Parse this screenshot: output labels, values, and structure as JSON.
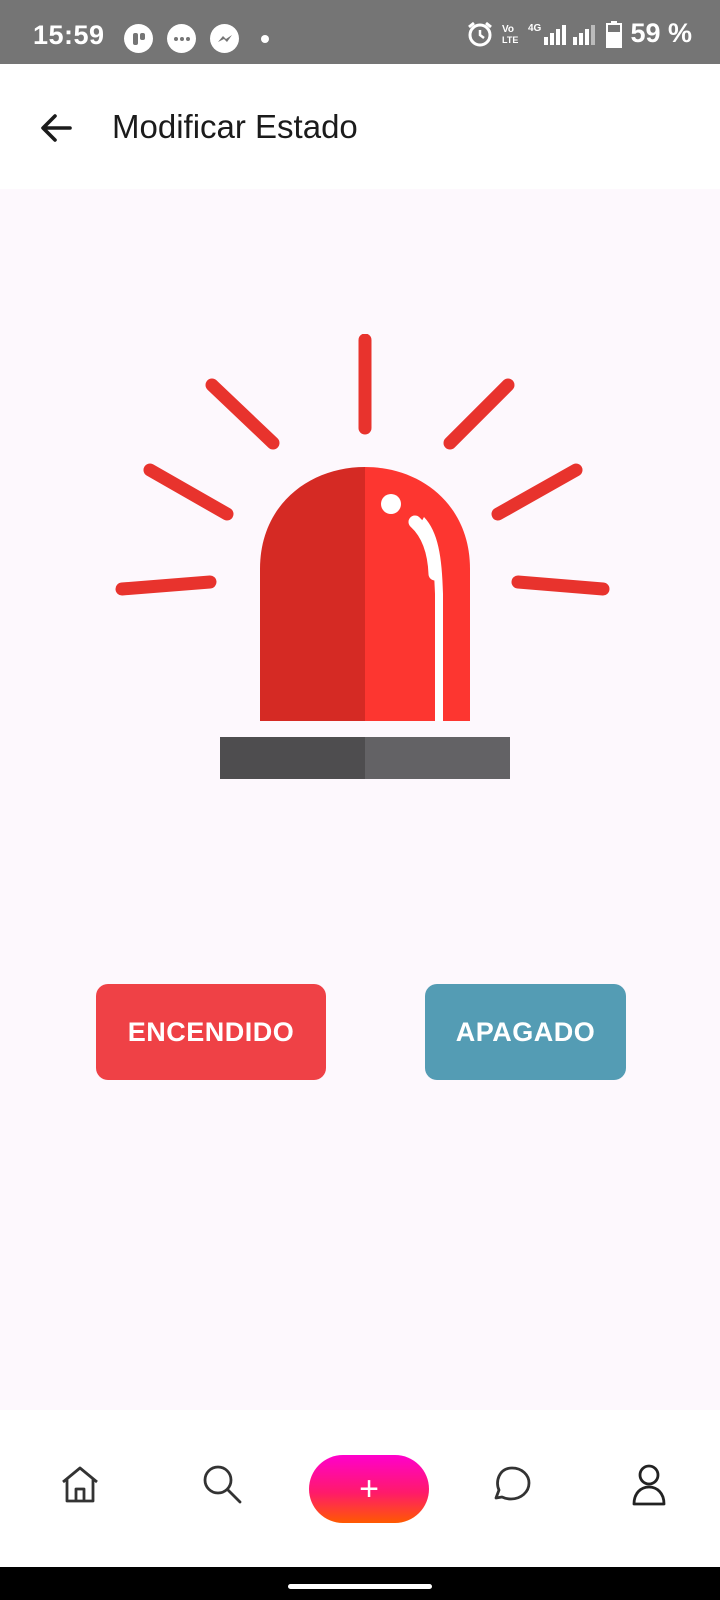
{
  "status_bar": {
    "time": "15:59",
    "battery": "59 %",
    "icons": [
      "notification-app-icon",
      "message-icon",
      "messenger-icon",
      "dot-icon",
      "alarm-icon",
      "volte-icon",
      "signal-4g-icon",
      "signal-icon",
      "battery-icon"
    ]
  },
  "app_bar": {
    "title": "Modificar Estado",
    "back_icon": "arrow-left-icon"
  },
  "main": {
    "image": "siren-alarm-icon",
    "on_button": "ENCENDIDO",
    "off_button": "APAGADO",
    "colors": {
      "on": "#ef4146",
      "off": "#549cb4",
      "siren_dark": "#d52a24",
      "siren_light": "#fd3630",
      "base_dark": "#4e4d4f",
      "base_light": "#636265"
    }
  },
  "bottom_nav": {
    "items": [
      "home-icon",
      "search-icon",
      "add-icon",
      "chat-icon",
      "profile-icon"
    ],
    "add_label": "+"
  }
}
